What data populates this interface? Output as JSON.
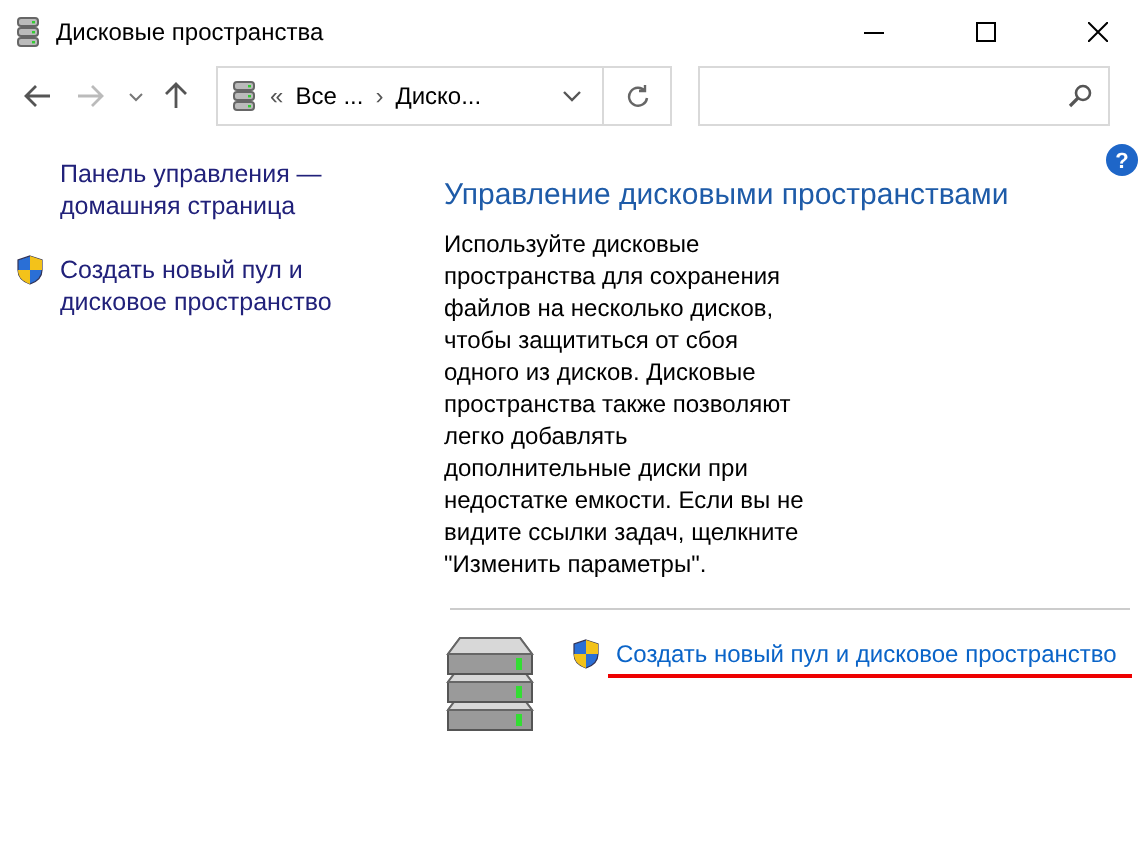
{
  "window": {
    "title": "Дисковые пространства"
  },
  "navigation": {
    "breadcrumbs": [
      "Все ...",
      "Диско..."
    ],
    "separator_first": "«",
    "separator": "›"
  },
  "help": {
    "label": "?"
  },
  "sidebar": {
    "items": [
      {
        "label": "Панель управления — домашняя страница",
        "kind": "link"
      },
      {
        "label": "Создать новый пул и дисковое пространство",
        "kind": "admin-link"
      }
    ]
  },
  "main": {
    "heading": "Управление дисковыми пространствами",
    "description": "Используйте дисковые пространства для сохранения файлов на несколько дисков, чтобы защититься от сбоя одного из дисков. Дисковые пространства также позволяют легко добавлять дополнительные диски при недостатке емкости. Если вы не видите ссылки задач, щелкните \"Изменить параметры\".",
    "task_link": "Создать новый пул и дисковое пространство"
  }
}
